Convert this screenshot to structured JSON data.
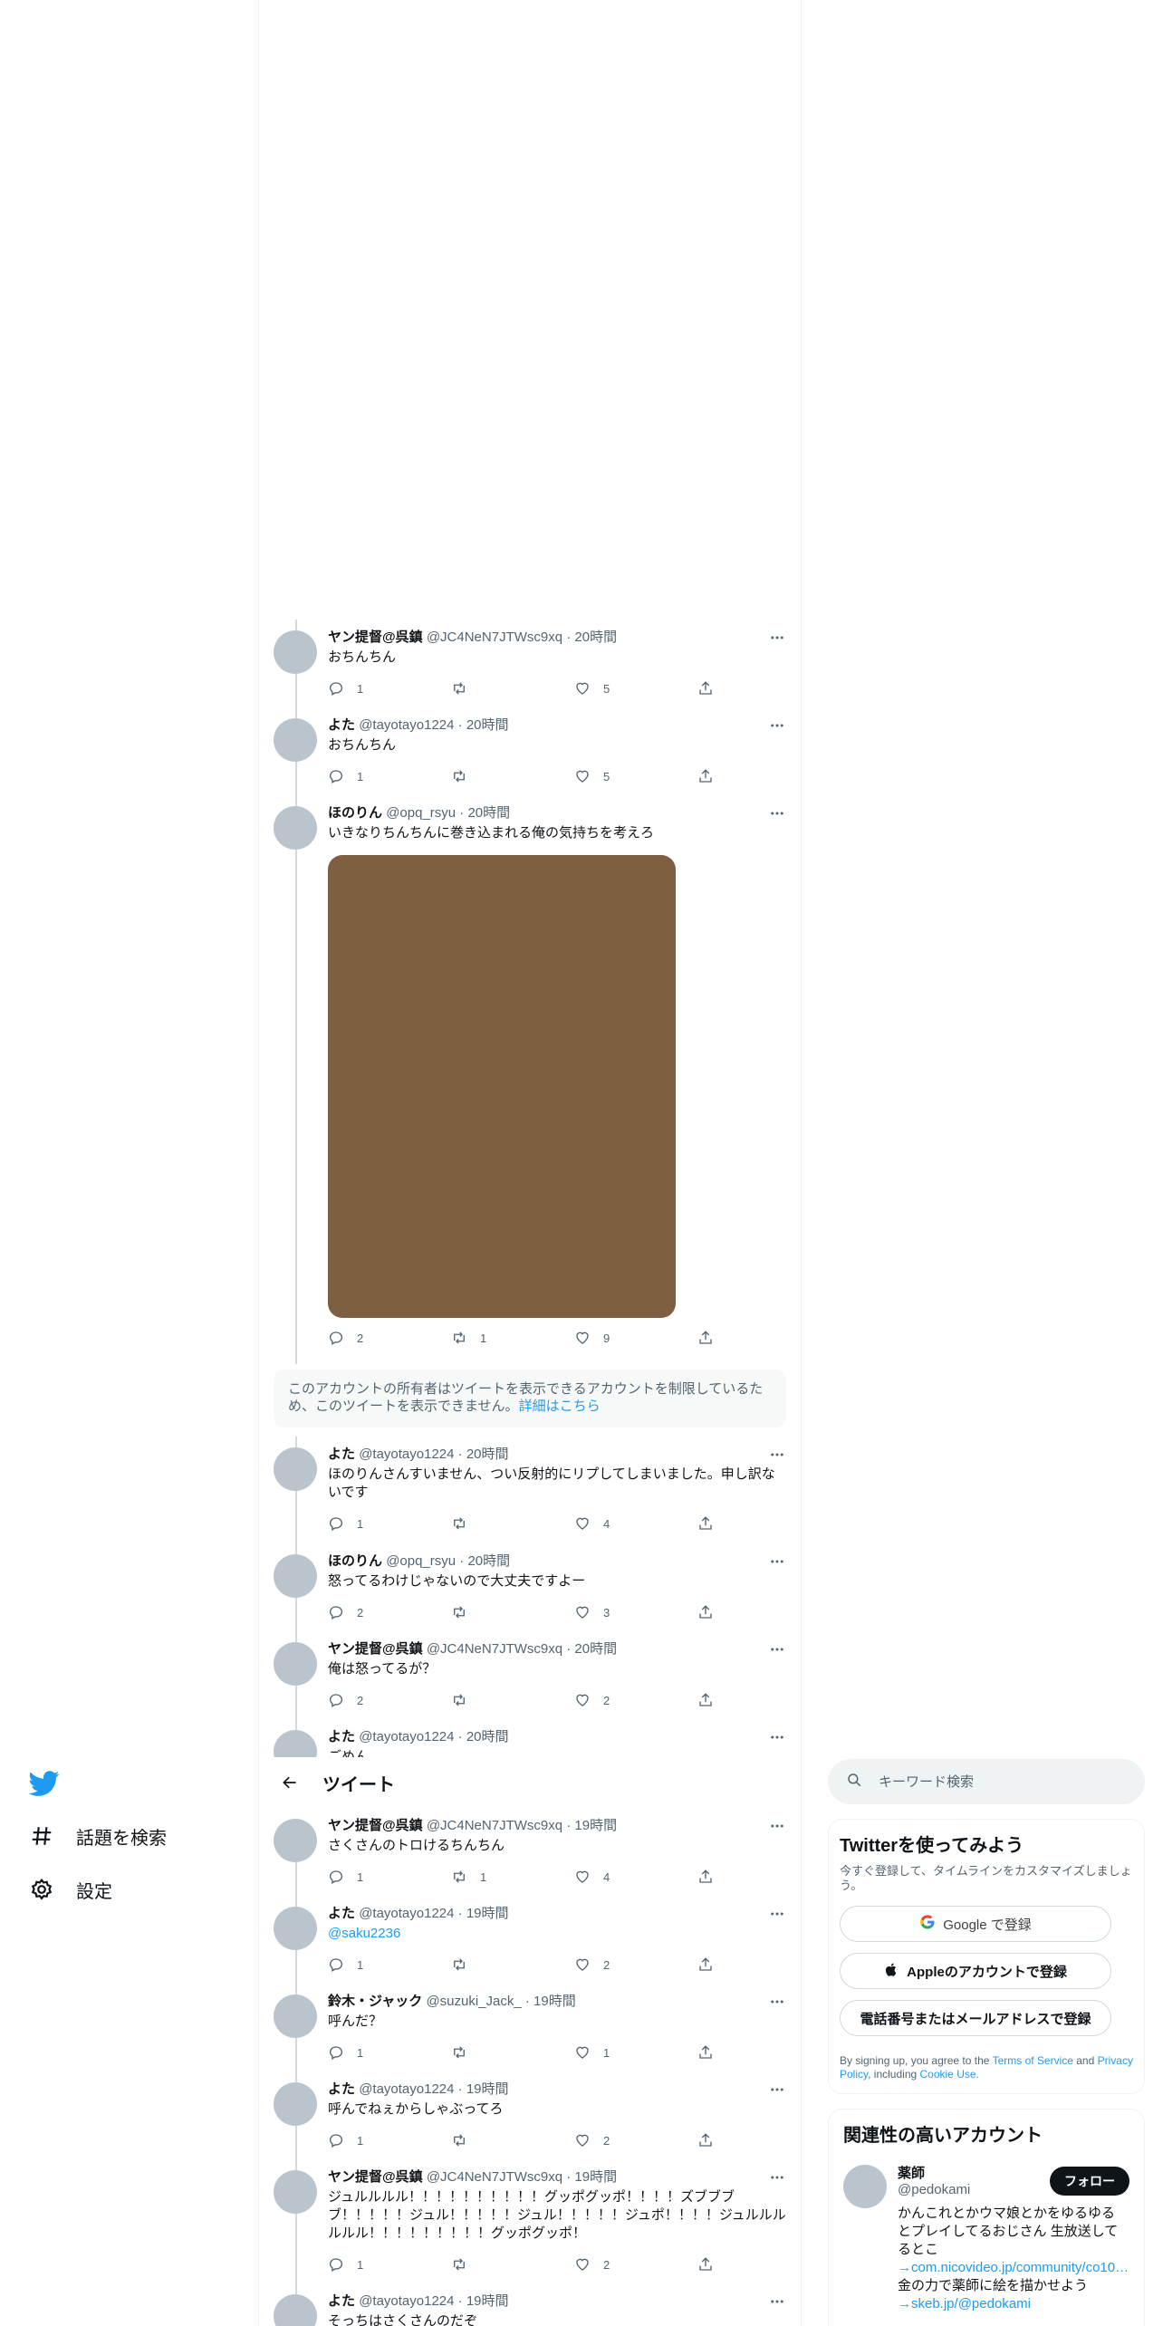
{
  "nav": {
    "items": [
      {
        "label": "話題を検索",
        "icon": "hashtag-icon"
      },
      {
        "label": "設定",
        "icon": "gear-icon"
      }
    ],
    "brand_color": "#1d9bf0"
  },
  "header": {
    "title": "ツイート"
  },
  "tweets": [
    {
      "name": "ヤン提督@呉鎮",
      "meta": "@JC4NeN7JTWsc9xq · 20時間",
      "text": "おちんちん",
      "replies": "1",
      "retweets": "",
      "likes": "5"
    },
    {
      "name": "よた",
      "meta": "@tayotayo1224 · 20時間",
      "text": "おちんちん",
      "replies": "1",
      "retweets": "",
      "likes": "5"
    },
    {
      "name": "ほのりん",
      "meta": "@opq_rsyu · 20時間",
      "text": "いきなりちんちんに巻き込まれる俺の気持ちを考えろ",
      "replies": "2",
      "retweets": "1",
      "likes": "9"
    },
    {
      "name": "よた",
      "meta": "@tayotayo1224 · 20時間",
      "text": "ほのりんさんすいません、つい反射的にリプしてしまいました。申し訳ないです",
      "replies": "1",
      "retweets": "",
      "likes": "4"
    },
    {
      "name": "ほのりん",
      "meta": "@opq_rsyu · 20時間",
      "text": "怒ってるわけじゃないので大丈夫ですよー",
      "replies": "2",
      "retweets": "",
      "likes": "3"
    },
    {
      "name": "ヤン提督@呉鎮",
      "meta": "@JC4NeN7JTWsc9xq · 20時間",
      "text": "俺は怒ってるが？",
      "replies": "2",
      "retweets": "",
      "likes": "2"
    },
    {
      "name": "よた",
      "meta": "@tayotayo1224 · 20時間",
      "text": "ごめん"
    },
    {
      "name": "ヤン提督@呉鎮",
      "meta": "@JC4NeN7JTWsc9xq · 19時間",
      "text": "さくさんのトロけるちんちん",
      "replies": "1",
      "retweets": "1",
      "likes": "4"
    },
    {
      "name": "よた",
      "meta": "@tayotayo1224 · 19時間",
      "text": "@saku2236",
      "replies": "1",
      "retweets": "",
      "likes": "2"
    },
    {
      "name": "鈴木・ジャック",
      "meta": "@suzuki_Jack_ · 19時間",
      "text": "呼んだ？",
      "replies": "1",
      "retweets": "",
      "likes": "1"
    },
    {
      "name": "よた",
      "meta": "@tayotayo1224 · 19時間",
      "text": "呼んでねぇからしゃぶってろ",
      "replies": "1",
      "retweets": "",
      "likes": "2"
    },
    {
      "name": "ヤン提督@呉鎮",
      "meta": "@JC4NeN7JTWsc9xq · 19時間",
      "text": "ジュルルルル！！！！！！！！！！グッポグッポ！！！！ズブブブブ！！！！！ジュル！！！！！ジュル！！！！！ジュポ！！！！ジュルルルルルル！！！！！！！！！グッポグッポ！",
      "replies": "1",
      "retweets": "",
      "likes": "2"
    },
    {
      "name": "よた",
      "meta": "@tayotayo1224 · 19時間",
      "text": "そっちはさくさんのだぞ"
    }
  ],
  "notice": {
    "text": "このアカウントの所有者はツイートを表示できるアカウントを制限しているため、このツイートを表示できません。",
    "link": "詳細はこちら"
  },
  "search": {
    "placeholder": "キーワード検索"
  },
  "signup": {
    "title": "Twitterを使ってみよう",
    "subtitle": "今すぐ登録して、タイムラインをカスタマイズしましょう。",
    "google_label": "Google で登録",
    "apple_label": "Appleのアカウントで登録",
    "phone_label": "電話番号またはメールアドレスで登録",
    "legal_pre": "By signing up, you agree to the ",
    "terms": "Terms of Service",
    "and": " and ",
    "privacy": "Privacy Policy",
    "including": ", including ",
    "cookie": "Cookie Use."
  },
  "related": {
    "title": "関連性の高いアカウント",
    "account": {
      "name": "薬師",
      "handle": "@pedokami",
      "follow_label": "フォロー",
      "bio_text": "かんこれとかウマ娘とかをゆるゆるとプレイしてるおじさん 生放送してるとこ",
      "bio_link1": "→com.nicovideo.jp/community/co10…",
      "bio_text2": "金の力で薬師に絵を描かせよう",
      "bio_link2": "→skeb.jp/@pedokami"
    }
  }
}
